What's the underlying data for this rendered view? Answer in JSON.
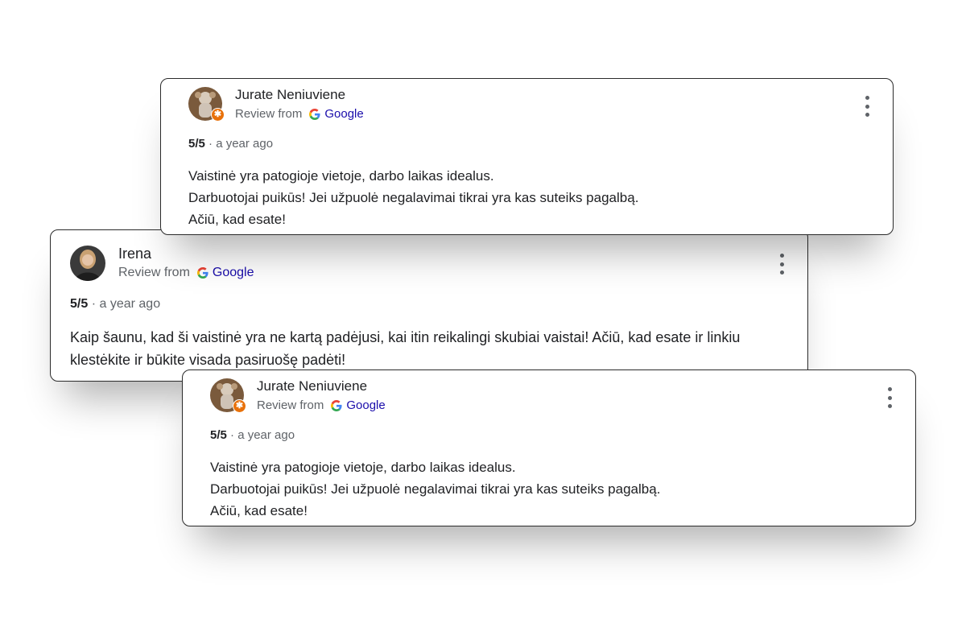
{
  "reviews": [
    {
      "name": "Jurate Neniuviene",
      "source_prefix": "Review from",
      "source_name": "Google",
      "rating": "5/5",
      "separator": "·",
      "time": "a year ago",
      "lines": [
        "Vaistinė yra patogioje vietoje, darbo laikas idealus.",
        "Darbuotojai puikūs! Jei užpuolė negalavimai tikrai yra kas suteiks pagalbą.",
        "Ačiū, kad esate!"
      ],
      "badge": "✱",
      "icons": {
        "avatar": "user-photo-icon",
        "menu": "more-vert-icon",
        "google": "google-g-icon"
      }
    },
    {
      "name": "Irena",
      "source_prefix": "Review from",
      "source_name": "Google",
      "rating": "5/5",
      "separator": "·",
      "time": "a year ago",
      "lines": [
        "Kaip šaunu, kad ši vaistinė yra ne kartą padėjusi, kai itin reikalingi skubiai vaistai! Ačiū, kad esate ir linkiu klestėkite ir būkite visada pasiruošę padėti!"
      ],
      "icons": {
        "avatar": "user-photo-icon",
        "menu": "more-vert-icon",
        "google": "google-g-icon"
      }
    },
    {
      "name": "Jurate Neniuviene",
      "source_prefix": "Review from",
      "source_name": "Google",
      "rating": "5/5",
      "separator": "·",
      "time": "a year ago",
      "lines": [
        "Vaistinė yra patogioje vietoje, darbo laikas idealus.",
        "Darbuotojai puikūs! Jei užpuolė negalavimai tikrai yra kas suteiks pagalbą.",
        "Ačiū, kad esate!"
      ],
      "badge": "✱",
      "icons": {
        "avatar": "user-photo-icon",
        "menu": "more-vert-icon",
        "google": "google-g-icon"
      }
    }
  ],
  "colors": {
    "google_link": "#1a0dab",
    "badge": "#e8710a",
    "text_primary": "#202124",
    "text_secondary": "#5f6368"
  }
}
